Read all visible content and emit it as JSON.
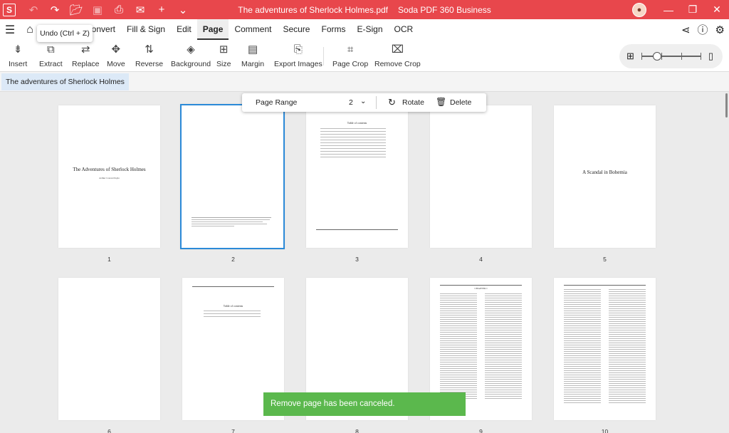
{
  "titlebar": {
    "logo": "S",
    "document_title": "The adventures of Sherlock Holmes.pdf",
    "app_name": "Soda PDF 360 Business",
    "avatar_initial": "",
    "icons": [
      "undo-icon",
      "redo-icon",
      "open-folder-icon",
      "save-icon",
      "print-icon",
      "mail-icon",
      "plus-icon",
      "chevron-down-icon"
    ]
  },
  "menu": {
    "items": [
      "Convert",
      "Fill & Sign",
      "Edit",
      "Page",
      "Comment",
      "Secure",
      "Forms",
      "E-Sign",
      "OCR"
    ],
    "active": "Page"
  },
  "tooltip": {
    "text": "Undo (Ctrl + Z)"
  },
  "toolbar": {
    "tools": [
      "Insert",
      "Extract",
      "Replace",
      "Move",
      "Reverse",
      "Background",
      "Size",
      "Margin",
      "Export Images",
      "Page Crop",
      "Remove Crop"
    ]
  },
  "breadcrumb": {
    "label": "The adventures of Sherlock Holmes"
  },
  "page_range": {
    "label": "Page Range",
    "value": "2",
    "rotate": "Rotate",
    "delete": "Delete"
  },
  "pages": {
    "row1": [
      "1",
      "2",
      "3",
      "4",
      "5"
    ],
    "row2": [
      "6",
      "7",
      "8",
      "9",
      "10"
    ],
    "p1_title": "The Adventures of Sherlock Holmes",
    "p1_author": "Arthur Conan Doyle",
    "p3_title": "Table of contents",
    "p5_title": "A Scandal in Bohemia",
    "p7_title": "Table of contents",
    "p9_chapter": "CHAPTER I"
  },
  "toast": {
    "message": "Remove page has been canceled."
  }
}
